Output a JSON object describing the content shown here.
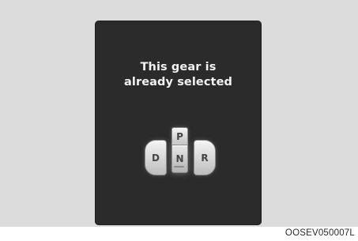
{
  "screen": {
    "message_line1": "This gear is",
    "message_line2": "already selected"
  },
  "gear_selector": {
    "p_label": "P",
    "n_label": "N",
    "d_label": "D",
    "r_label": "R",
    "selected": "N"
  },
  "figure_code": "OOSEV050007L",
  "colors": {
    "screen_background": "#2b2b2b",
    "frame_background": "#dcdcdc",
    "message_text": "#f2f2f2",
    "button_face": "#e6e6e6"
  }
}
